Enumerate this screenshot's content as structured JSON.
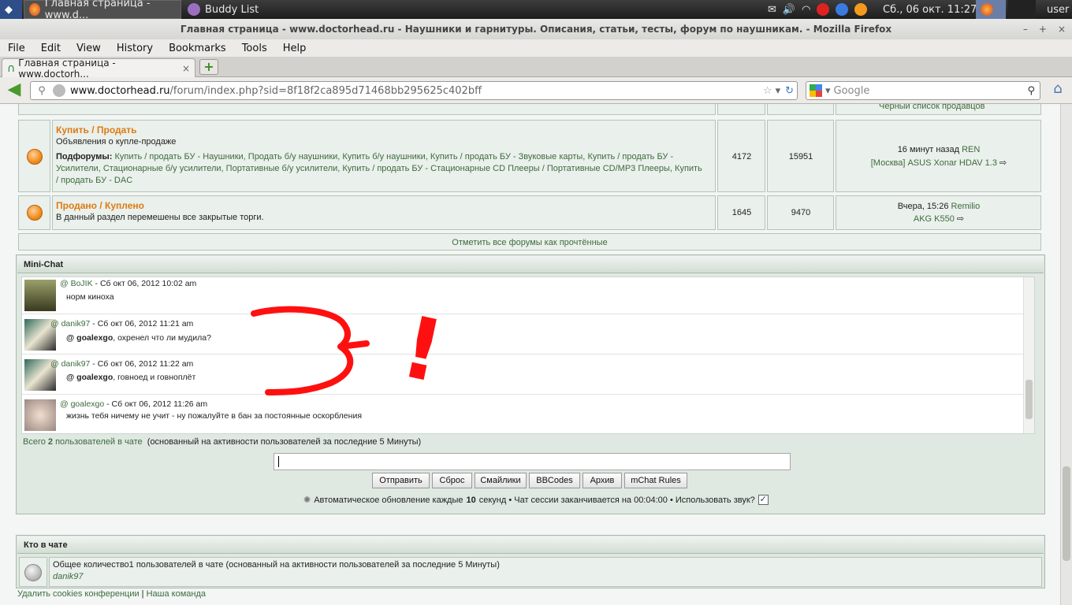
{
  "panel": {
    "task1": "Главная страница - www.d...",
    "task2": "Buddy List",
    "clock": "Сб., 06 окт.  11:27",
    "user": "user"
  },
  "window": {
    "title": "Главная страница - www.doctorhead.ru - Наушники и гарнитуры. Описания, статьи, тесты, форум по наушникам. - Mozilla Firefox",
    "min": "–",
    "max": "+",
    "close": "×"
  },
  "menu": [
    "File",
    "Edit",
    "View",
    "History",
    "Bookmarks",
    "Tools",
    "Help"
  ],
  "tab": {
    "label": "Главная страница - www.doctorh...",
    "close": "×",
    "new": "+"
  },
  "nav": {
    "url_host_pre": "www.",
    "url_host": "doctorhead.ru",
    "url_path": "/forum/index.php?sid=8f18f2ca895d71468bb295625c402bff",
    "search_placeholder": "Google"
  },
  "forum": {
    "top_partial": "Черный список продавцов",
    "rows": [
      {
        "title": "Купить / Продать",
        "desc": "Объявления о купле-продаже",
        "sub_label": "Подфорумы:",
        "subforums": [
          "Купить / продать БУ - Наушники,",
          "Продать б/у наушники,",
          "Купить б/у наушники,",
          "Купить / продать БУ - Звуковые карты,",
          "Купить / продать БУ - Усилители,",
          "Стационарные б/у усилители,",
          "Портативные б/у усилители,",
          "Купить / продать БУ - Стационарные CD Плееры / Портативные CD/MP3 Плееры,",
          "Купить / продать БУ - DAC"
        ],
        "topics": "4172",
        "posts": "15951",
        "last_time": "16 минут назад",
        "last_user": "REN",
        "last_topic": "[Москва] ASUS Xonar HDAV 1.3"
      },
      {
        "title": "Продано / Куплено",
        "desc": "В данный раздел перемешены все закрытые торги.",
        "topics": "1645",
        "posts": "9470",
        "last_time": "Вчера, 15:26",
        "last_user": "Remilio",
        "last_topic": "AKG K550"
      }
    ],
    "mark_read": "Отметить все форумы как прочтённые"
  },
  "chat": {
    "title": "Mini-Chat",
    "messages": [
      {
        "at": "@",
        "user": "BoJIK",
        "time": "- Сб окт 06, 2012 10:02 am",
        "mention": "",
        "text": "норм киноха"
      },
      {
        "at": "@",
        "user": "danik97",
        "time": "- Сб окт 06, 2012 11:21 am",
        "mention": "@ goalexgo",
        "text": ", охренел что ли мудила?"
      },
      {
        "at": "@",
        "user": "danik97",
        "time": "- Сб окт 06, 2012 11:22 am",
        "mention": "@ goalexgo",
        "text": ", говноед и говноплёт"
      },
      {
        "at": "@",
        "user": "goalexgo",
        "time": "- Сб окт 06, 2012 11:26 am",
        "mention": "",
        "text": "жизнь тебя ничему не учит - ну пожалуйте в бан за постоянные оскорбления"
      }
    ],
    "total_pre": "Всего",
    "total_num": "2",
    "total_post": "пользователей в чате",
    "total_note": "(основанный на активности пользователей за последние 5 Минуты)",
    "buttons": [
      "Отправить",
      "Сброс",
      "Смайлики",
      "BBCodes",
      "Архив",
      "mChat Rules"
    ],
    "auto_pre": "Автоматическое обновление каждые",
    "auto_num": "10",
    "auto_post": "секунд • Чат сессии заканчивается на 00:04:00 • Использовать звук?"
  },
  "who": {
    "title": "Кто в чате",
    "line": "Общее количество1 пользователей в чате (основанный на активности пользователей за последние 5 Минуты)",
    "user": "danik97"
  },
  "footer": {
    "cookies": "Удалить cookies конференции",
    "sep": "|",
    "team": "Наша команда"
  },
  "annotation": {
    "text": "!"
  }
}
